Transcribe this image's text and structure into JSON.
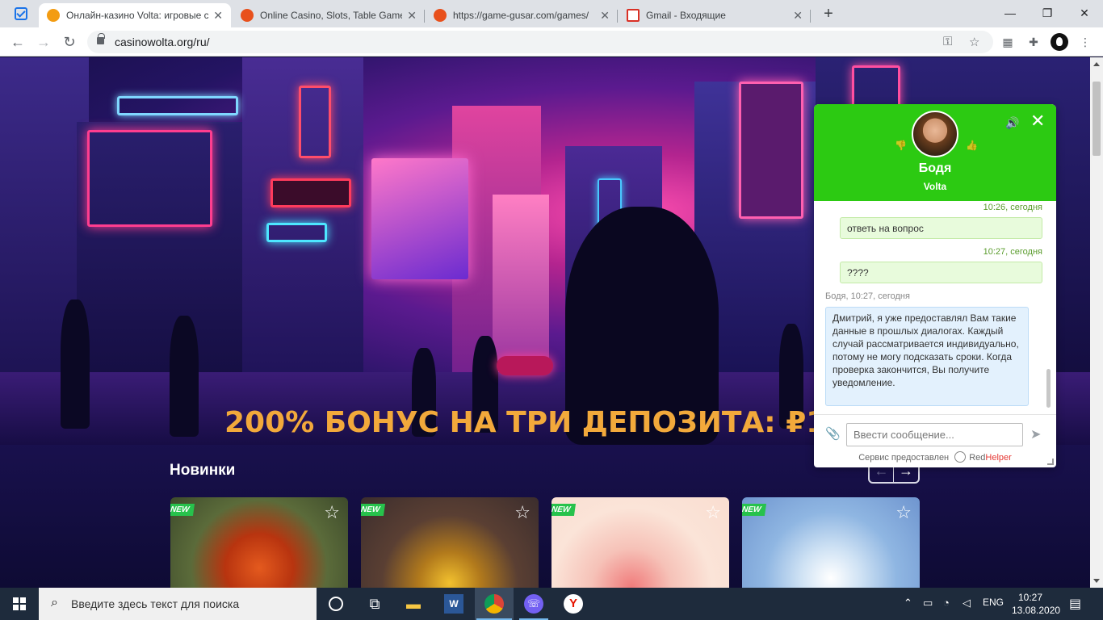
{
  "browser": {
    "tabs": [
      {
        "title": "Онлайн-казино Volta: игровые с",
        "active": true
      },
      {
        "title": "Online Casino, Slots, Table Game",
        "active": false
      },
      {
        "title": "https://game-gusar.com/games/",
        "active": false
      },
      {
        "title": "Gmail - Входящие",
        "active": false
      }
    ],
    "url": "casinowolta.org/ru/"
  },
  "page": {
    "banner_text": "200% БОНУС НА ТРИ ДЕПОЗИТА: ₽150 000 + 15",
    "section_title": "Новинки",
    "new_badge": "NEW",
    "carousel_prev": "←",
    "carousel_next": "→"
  },
  "chat": {
    "agent_name": "Бодя",
    "company": "Volta",
    "messages": [
      {
        "time": "10:26, сегодня",
        "author": "me",
        "text": "ответь на вопрос"
      },
      {
        "time": "10:27, сегодня",
        "author": "me",
        "text": "????"
      },
      {
        "time": "Бодя, 10:27, сегодня",
        "author": "agent",
        "text": "Дмитрий, я уже предоставлял Вам такие данные в прошлых диалогах. Каждый случай рассматривается индивидуально, потому не могу подсказать сроки. Когда проверка закончится, Вы получите уведомление."
      }
    ],
    "input_placeholder": "Ввести сообщение...",
    "footer_prefix": "Сервис предоставлен",
    "footer_brand_a": "Red",
    "footer_brand_b": "Helper"
  },
  "taskbar": {
    "search_placeholder": "Введите здесь текст для поиска",
    "language": "ENG",
    "time": "10:27",
    "date": "13.08.2020"
  },
  "colors": {
    "chat_header": "#2cca12",
    "banner_text": "#f2a93b",
    "new_badge": "#27c24c"
  }
}
